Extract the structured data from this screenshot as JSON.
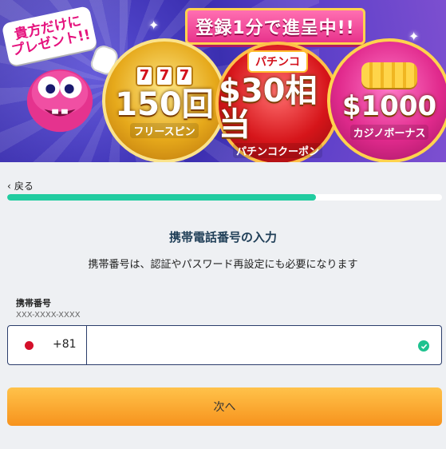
{
  "banner": {
    "left_tag": "貴方だけに\nプレゼント!!",
    "top_ribbon": "登録1分で進呈中!!",
    "medal1": {
      "reels": [
        "7",
        "7",
        "7"
      ],
      "amount": "150回",
      "label": "フリースピン"
    },
    "medal2": {
      "badge": "パチンコ",
      "amount": "$30相当",
      "label": "パチンコクーポン"
    },
    "medal3": {
      "amount": "$1000",
      "label": "カジノボーナス"
    }
  },
  "nav": {
    "back_label": "戻る"
  },
  "progress": {
    "fraction": 0.71
  },
  "form": {
    "title": "携帯電話番号の入力",
    "subtitle": "携帯番号は、認証やパスワード再設定にも必要になります",
    "phone_label": "携帯番号",
    "phone_hint": "XXX-XXXX-XXXX",
    "country_code": "+81",
    "phone_value": "",
    "next_label": "次へ"
  },
  "colors": {
    "accent_green": "#21cca0",
    "button_orange": "#f7931d",
    "title_navy": "#1f3e57",
    "flag_red": "#d4102a"
  },
  "icons": [
    "chevron-left-icon",
    "japan-flag-icon",
    "check-circle-icon",
    "mascot-icon"
  ]
}
